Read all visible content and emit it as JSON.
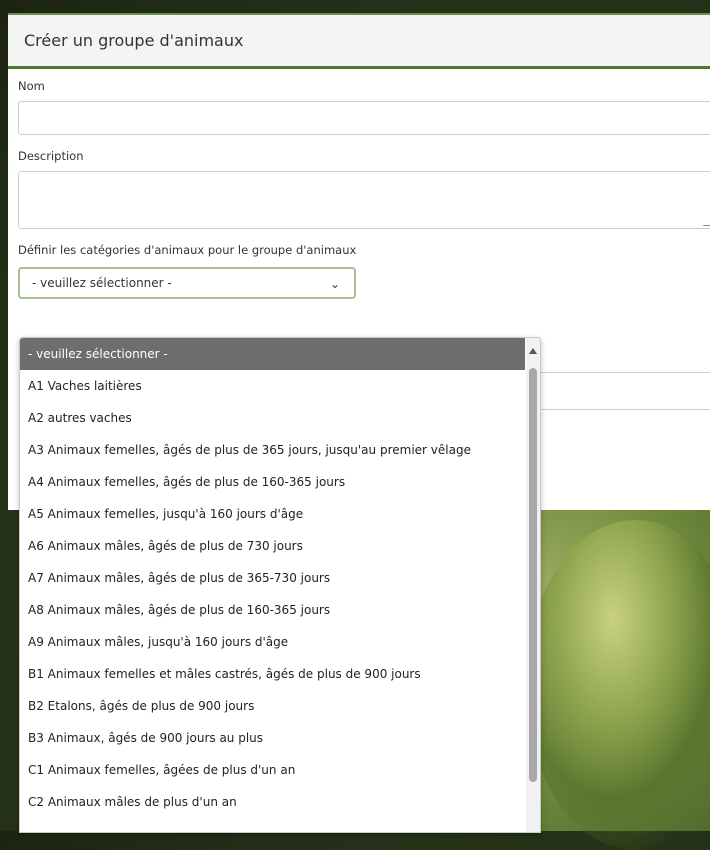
{
  "modal": {
    "title": "Créer un groupe d'animaux"
  },
  "form": {
    "name_label": "Nom",
    "description_label": "Description",
    "categories_label": "Définir les catégories d'animaux pour le groupe d'animaux",
    "select_value": "- veuillez sélectionner -"
  },
  "icons": {
    "select_arrow": "chevron-down-icon",
    "scroll_up": "triangle-up-icon",
    "resize": "resize-grip-icon"
  },
  "dropdown": {
    "options": [
      "- veuillez sélectionner -",
      "A1 Vaches laitières",
      "A2 autres vaches",
      "A3 Animaux femelles, âgés de plus de 365 jours, jusqu'au premier vêlage",
      "A4 Animaux femelles, âgés de plus de 160-365 jours",
      "A5 Animaux femelles, jusqu'à 160 jours d'âge",
      "A6 Animaux mâles, âgés de plus de 730 jours",
      "A7 Animaux mâles, âgés de plus de 365-730 jours",
      "A8 Animaux mâles, âgés de plus de 160-365 jours",
      "A9 Animaux mâles, jusqu'à 160 jours d'âge",
      "B1 Animaux femelles et mâles castrés, âgés de plus de 900 jours",
      "B2 Etalons, âgés de plus de 900 jours",
      "B3 Animaux, âgés de 900 jours au plus",
      "C1 Animaux femelles, âgées de plus d'un an",
      "C2 Animaux mâles de plus d'un an"
    ],
    "selected_index": 0
  },
  "colors": {
    "accent_green": "#4a7a2e",
    "selected_option_bg": "#6e6e6e"
  }
}
